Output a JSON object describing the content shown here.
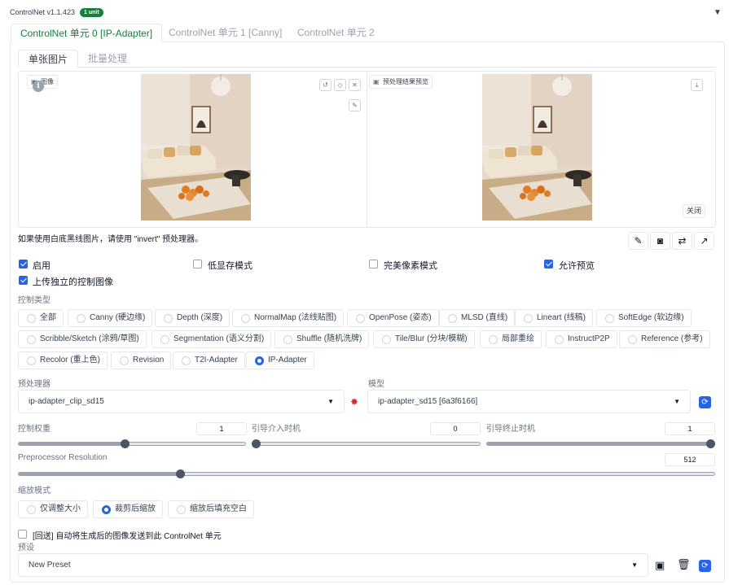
{
  "header": {
    "title": "ControlNet v1.1.423",
    "badge": "1 unit",
    "collapse_icon": "triangle-down-icon"
  },
  "unit_tabs": [
    {
      "label": "ControlNet 单元 0 [IP-Adapter]",
      "active": true
    },
    {
      "label": "ControlNet 单元 1 [Canny]",
      "active": false
    },
    {
      "label": "ControlNet 单元 2",
      "active": false
    }
  ],
  "sub_tabs": [
    {
      "label": "单张图片",
      "active": true
    },
    {
      "label": "批量处理",
      "active": false
    }
  ],
  "input_panel": {
    "label": "图像",
    "tools": [
      "undo-icon",
      "eraser-icon",
      "close-icon",
      "brush-icon"
    ]
  },
  "preview_panel": {
    "label": "预处理结果预览",
    "download_icon": "download-icon",
    "close_label": "关闭"
  },
  "hint": "如果使用白底黑线图片，请使用 \"invert\" 预处理器。",
  "action_icons": [
    "edit-icon",
    "camera-icon",
    "swap-icon",
    "send-icon"
  ],
  "checkboxes": {
    "enable": {
      "label": "启用",
      "checked": true
    },
    "low_vram": {
      "label": "低显存模式",
      "checked": false
    },
    "pixel_perfect": {
      "label": "完美像素模式",
      "checked": false
    },
    "allow_preview": {
      "label": "允许预览",
      "checked": true
    },
    "upload_independent": {
      "label": "上传独立的控制图像",
      "checked": true
    }
  },
  "control_type": {
    "label": "控制类型",
    "options": [
      "全部",
      "Canny (硬边缘)",
      "Depth (深度)",
      "NormalMap (法线贴图)",
      "OpenPose (姿态)",
      "MLSD (直线)",
      "Lineart (线稿)",
      "SoftEdge (软边缘)",
      "Scribble/Sketch (涂鸦/草图)",
      "Segmentation (语义分割)",
      "Shuffle (随机洗牌)",
      "Tile/Blur (分块/模糊)",
      "局部重绘",
      "InstructP2P",
      "Reference (参考)",
      "Recolor (重上色)",
      "Revision",
      "T2I-Adapter",
      "IP-Adapter"
    ],
    "selected": "IP-Adapter"
  },
  "preprocessor": {
    "label": "预处理器",
    "value": "ip-adapter_clip_sd15",
    "run_icon": "explosion-icon"
  },
  "model": {
    "label": "模型",
    "value": "ip-adapter_sd15 [6a3f6166]",
    "refresh_icon": "refresh-icon"
  },
  "control_weight": {
    "label": "控制权重",
    "value": "1",
    "fraction": 0.47
  },
  "start_step": {
    "label": "引导介入时机",
    "value": "0",
    "fraction": 0.0
  },
  "end_step": {
    "label": "引导终止时机",
    "value": "1",
    "fraction": 1.0
  },
  "preprocessor_resolution": {
    "label": "Preprocessor Resolution",
    "value": "512",
    "fraction": 0.23
  },
  "resize_mode": {
    "label": "缩放模式",
    "options": [
      "仅调整大小",
      "裁剪后缩放",
      "缩放后填充空白"
    ],
    "selected": "裁剪后缩放"
  },
  "loopback": {
    "label": "[回送] 自动将生成后的图像发送到此 ControlNet 单元",
    "checked": false
  },
  "preset": {
    "label": "预设",
    "value": "New Preset",
    "icons": [
      "save-icon",
      "trash-icon",
      "refresh-icon"
    ]
  },
  "colors": {
    "accent": "#2563eb",
    "green": "#15803d"
  }
}
